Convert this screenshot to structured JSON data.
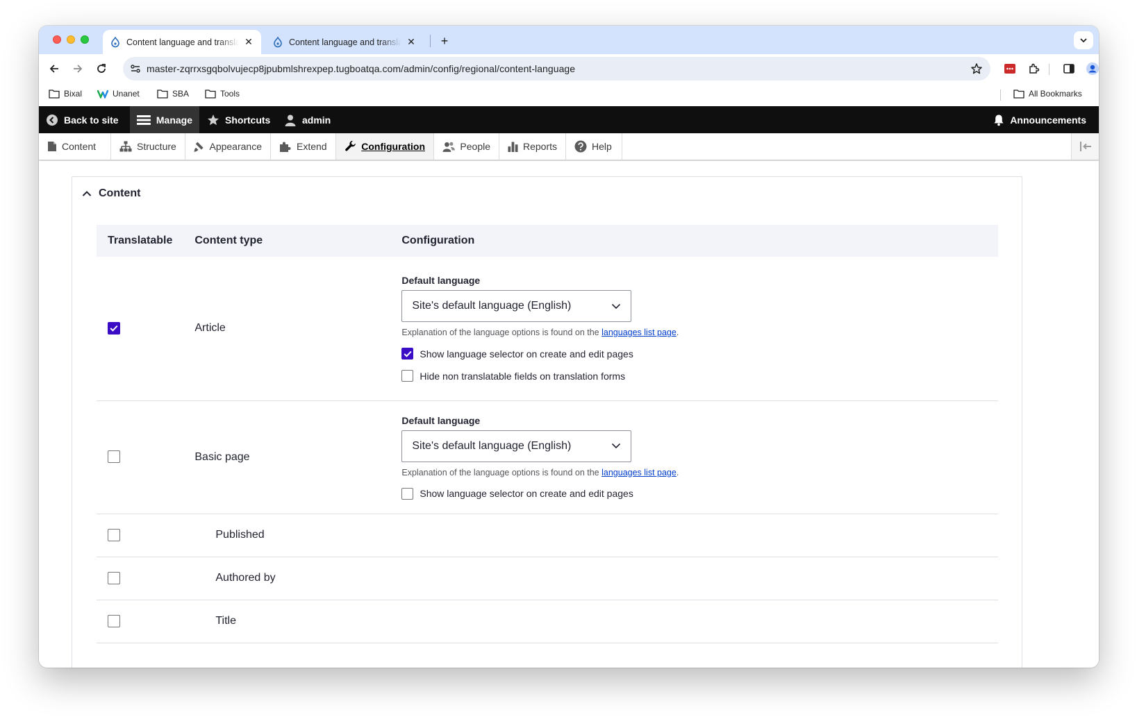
{
  "browser": {
    "tabs": [
      {
        "title": "Content language and translation",
        "active": true
      },
      {
        "title": "Content language and translation",
        "active": false
      }
    ],
    "url": "master-zqrrxsgqbolvujecp8jpubmlshrexpep.tugboatqa.com/admin/config/regional/content-language",
    "bookmarks": [
      {
        "label": "Bixal",
        "icon": "folder-icon"
      },
      {
        "label": "Unanet",
        "icon": "unanet-logo-icon"
      },
      {
        "label": "SBA",
        "icon": "folder-icon"
      },
      {
        "label": "Tools",
        "icon": "folder-icon"
      }
    ],
    "all_bookmarks": "All Bookmarks",
    "colors": {
      "tab_strip": "#d3e3fd",
      "omnibox": "#e9eef6"
    }
  },
  "drupal_toolbar": {
    "back_to_site": "Back to site",
    "manage": "Manage",
    "shortcuts": "Shortcuts",
    "user": "admin",
    "announcements": "Announcements"
  },
  "admin_tray": {
    "items": [
      {
        "label": "Content",
        "icon": "file-icon"
      },
      {
        "label": "Structure",
        "icon": "structure-icon"
      },
      {
        "label": "Appearance",
        "icon": "brush-icon"
      },
      {
        "label": "Extend",
        "icon": "puzzle-icon"
      },
      {
        "label": "Configuration",
        "icon": "wrench-icon",
        "active": true
      },
      {
        "label": "People",
        "icon": "people-icon"
      },
      {
        "label": "Reports",
        "icon": "reports-icon"
      },
      {
        "label": "Help",
        "icon": "help-icon"
      }
    ]
  },
  "section": {
    "title": "Content",
    "columns": [
      "Translatable",
      "Content type",
      "Configuration"
    ],
    "rows": [
      {
        "name": "Article",
        "translatable": true,
        "default_language_label": "Default language",
        "default_language_value": "Site's default language (English)",
        "description_prefix": "Explanation of the language options is found on the ",
        "description_link": "languages list page",
        "description_suffix": ".",
        "options": [
          {
            "label": "Show language selector on create and edit pages",
            "checked": true
          },
          {
            "label": "Hide non translatable fields on translation forms",
            "checked": false
          }
        ]
      },
      {
        "name": "Basic page",
        "translatable": false,
        "default_language_label": "Default language",
        "default_language_value": "Site's default language (English)",
        "description_prefix": "Explanation of the language options is found on the ",
        "description_link": "languages list page",
        "description_suffix": ".",
        "options": [
          {
            "label": "Show language selector on create and edit pages",
            "checked": false
          }
        ]
      }
    ],
    "fields": [
      {
        "name": "Published",
        "checked": false
      },
      {
        "name": "Authored by",
        "checked": false
      },
      {
        "name": "Title",
        "checked": false
      }
    ],
    "accent_color": "#3b0cc5",
    "link_color": "#003ecc"
  }
}
